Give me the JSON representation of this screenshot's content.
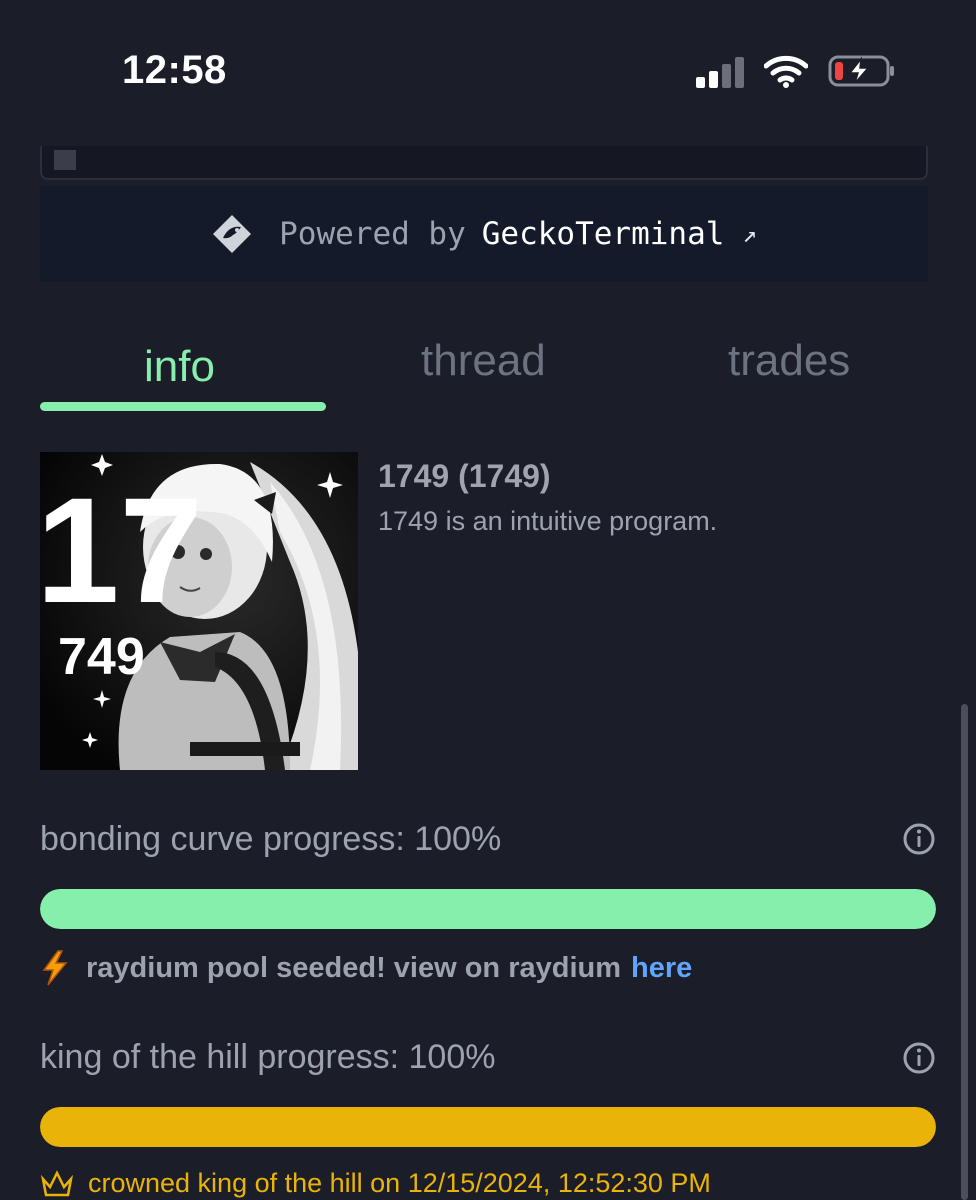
{
  "status_bar": {
    "time": "12:58",
    "icons": [
      "cellular-signal-icon",
      "wifi-icon",
      "battery-charging-icon"
    ]
  },
  "powered_by": {
    "prefix": "Powered by",
    "brand": "GeckoTerminal",
    "arrow": "↗",
    "icon": "gecko-icon"
  },
  "tabs": [
    {
      "label": "info",
      "active": true
    },
    {
      "label": "thread",
      "active": false
    },
    {
      "label": "trades",
      "active": false
    }
  ],
  "token": {
    "title": "1749 (1749)",
    "description": "1749 is an intuitive program.",
    "image_text_top": "17",
    "image_text_bottom": "749"
  },
  "bonding_curve": {
    "label": "bonding curve progress: 100%",
    "progress": 1.0,
    "color": "#86efac"
  },
  "raydium_notice": {
    "text": "raydium pool seeded! view on raydium",
    "link": "here",
    "link_color": "#60a5fa",
    "icon": "lightning-icon"
  },
  "king_of_hill": {
    "label": "king of the hill progress: 100%",
    "progress": 1.0,
    "color": "#eab308"
  },
  "crowned": {
    "text": "crowned king of the hill on 12/15/2024, 12:52:30 PM",
    "icon": "crown-icon"
  }
}
